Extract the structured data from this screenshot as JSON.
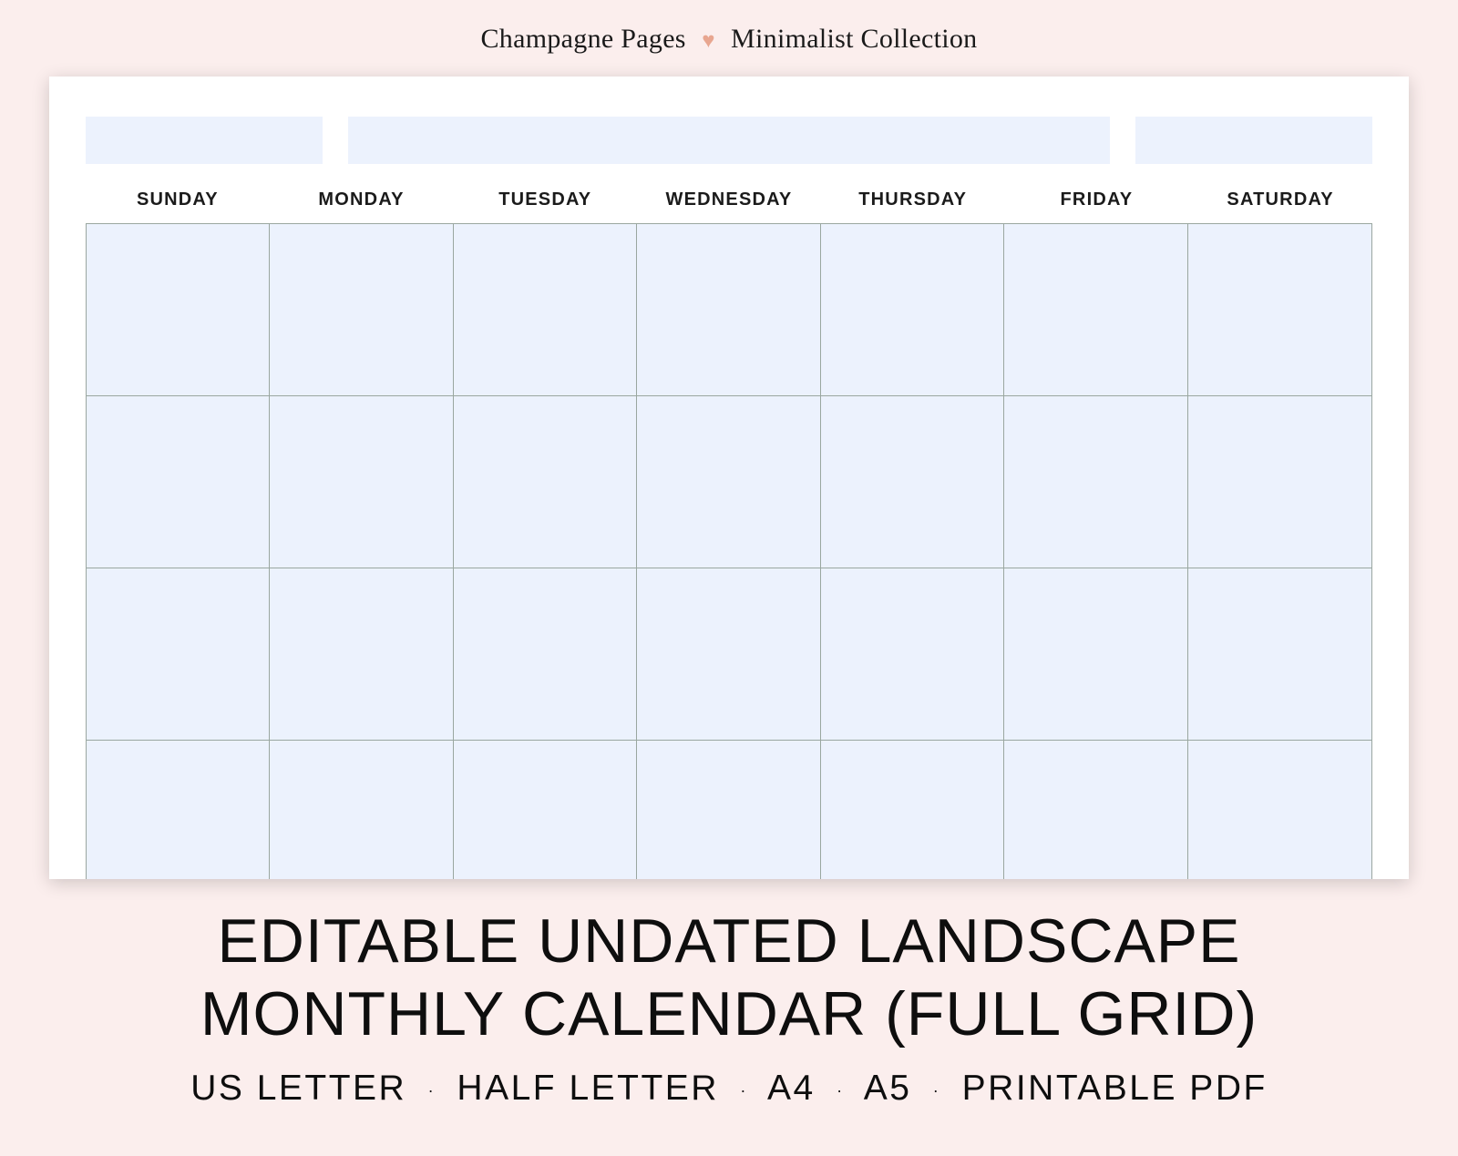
{
  "header": {
    "brand_left": "Champagne Pages",
    "brand_right": "Minimalist Collection",
    "heart_glyph": "♥"
  },
  "calendar": {
    "days": [
      "SUNDAY",
      "MONDAY",
      "TUESDAY",
      "WEDNESDAY",
      "THURSDAY",
      "FRIDAY",
      "SATURDAY"
    ],
    "rows": 5,
    "cols": 7,
    "cell_fill_color": "#ecf2fd",
    "grid_line_color": "#9aa7a0"
  },
  "caption": {
    "title_line_1": "EDITABLE UNDATED LANDSCAPE",
    "title_line_2": "MONTHLY CALENDAR (FULL GRID)",
    "formats": [
      "US LETTER",
      "HALF LETTER",
      "A4",
      "A5",
      "PRINTABLE PDF"
    ],
    "separator": "·"
  }
}
